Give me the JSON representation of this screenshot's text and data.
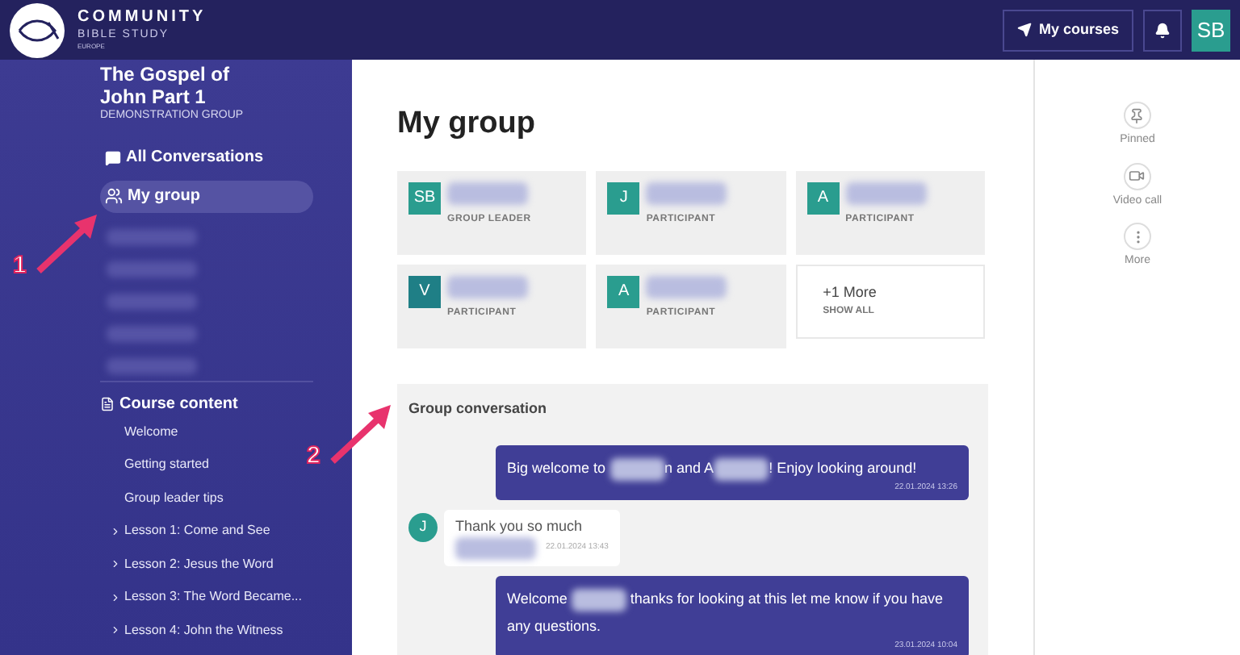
{
  "header": {
    "brand": "COMMUNITY",
    "brand_sub": "BIBLE STUDY",
    "brand_region": "EUROPE",
    "my_courses": "My courses",
    "avatar": "SB"
  },
  "sidebar": {
    "course_title": "The Gospel of John Part 1",
    "group_name": "DEMONSTRATION GROUP",
    "nav": [
      {
        "label": "All Conversations",
        "selected": false
      },
      {
        "label": "My group",
        "selected": true
      }
    ],
    "section_title": "Course content",
    "items": [
      {
        "label": "Welcome",
        "expandable": false
      },
      {
        "label": "Getting started",
        "expandable": false
      },
      {
        "label": "Group leader tips",
        "expandable": false
      },
      {
        "label": "Lesson 1: Come and See",
        "expandable": true
      },
      {
        "label": "Lesson 2: Jesus the Word",
        "expandable": true
      },
      {
        "label": "Lesson 3: The Word Became...",
        "expandable": true
      },
      {
        "label": "Lesson 4: John the Witness",
        "expandable": true
      }
    ]
  },
  "main": {
    "title": "My group",
    "members": [
      {
        "initials": "SB",
        "role": "GROUP LEADER",
        "color": "#2a9d8f"
      },
      {
        "initials": "J",
        "role": "PARTICIPANT",
        "color": "#2a9d8f"
      },
      {
        "initials": "A",
        "role": "PARTICIPANT",
        "color": "#2a9d8f"
      },
      {
        "initials": "V",
        "role": "PARTICIPANT",
        "color": "#1f7f86"
      },
      {
        "initials": "A",
        "role": "PARTICIPANT",
        "color": "#2a9d8f"
      }
    ],
    "more": {
      "count": "+1 More",
      "action": "SHOW ALL"
    },
    "conversation": {
      "title": "Group conversation",
      "messages": [
        {
          "kind": "own",
          "parts": [
            {
              "kind": "text",
              "text": "Big welcome to "
            },
            {
              "kind": "blur"
            },
            {
              "kind": "text",
              "text": "n and A"
            },
            {
              "kind": "blur"
            },
            {
              "kind": "text",
              "text": "! Enjoy looking around!"
            }
          ],
          "time": "22.01.2024 13:26"
        },
        {
          "kind": "other",
          "initials": "J",
          "parts": [
            {
              "kind": "text",
              "text": "Thank you so much"
            }
          ],
          "time": "22.01.2024 13:43"
        },
        {
          "kind": "own",
          "parts": [
            {
              "kind": "text",
              "text": "Welcome "
            },
            {
              "kind": "blur"
            },
            {
              "kind": "text",
              "text": " thanks for looking at this let me know if you have any questions."
            }
          ],
          "time": "23.01.2024 10:04"
        }
      ]
    }
  },
  "rail": [
    {
      "label": "Pinned"
    },
    {
      "label": "Video call"
    },
    {
      "label": "More"
    }
  ],
  "annotations": [
    {
      "label": "1"
    },
    {
      "label": "2"
    }
  ]
}
